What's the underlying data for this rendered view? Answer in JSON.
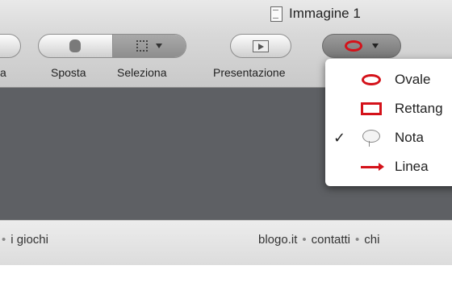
{
  "window": {
    "title": "Immagine 1",
    "title_icon": "document-icon"
  },
  "toolbar": {
    "left_cut_label": "a",
    "move_label": "Sposta",
    "select_label": "Seleziona",
    "presentation_label": "Presentazione",
    "shape_tool_icon": "oval-icon"
  },
  "shape_menu": {
    "items": [
      {
        "label": "Ovale",
        "icon": "oval-icon",
        "checked": false
      },
      {
        "label": "Rettang",
        "icon": "rectangle-icon",
        "checked": false
      },
      {
        "label": "Nota",
        "icon": "note-icon",
        "checked": true,
        "check_mark": "✓"
      },
      {
        "label": "Linea",
        "icon": "arrow-line-icon",
        "checked": false
      }
    ]
  },
  "webpage": {
    "left_links": [
      "i giochi"
    ],
    "right_links": [
      "blogo.it",
      "contatti",
      "chi"
    ],
    "separator": "•"
  },
  "colors": {
    "accent_red": "#d4121a",
    "canvas_gray": "#5e6064"
  }
}
